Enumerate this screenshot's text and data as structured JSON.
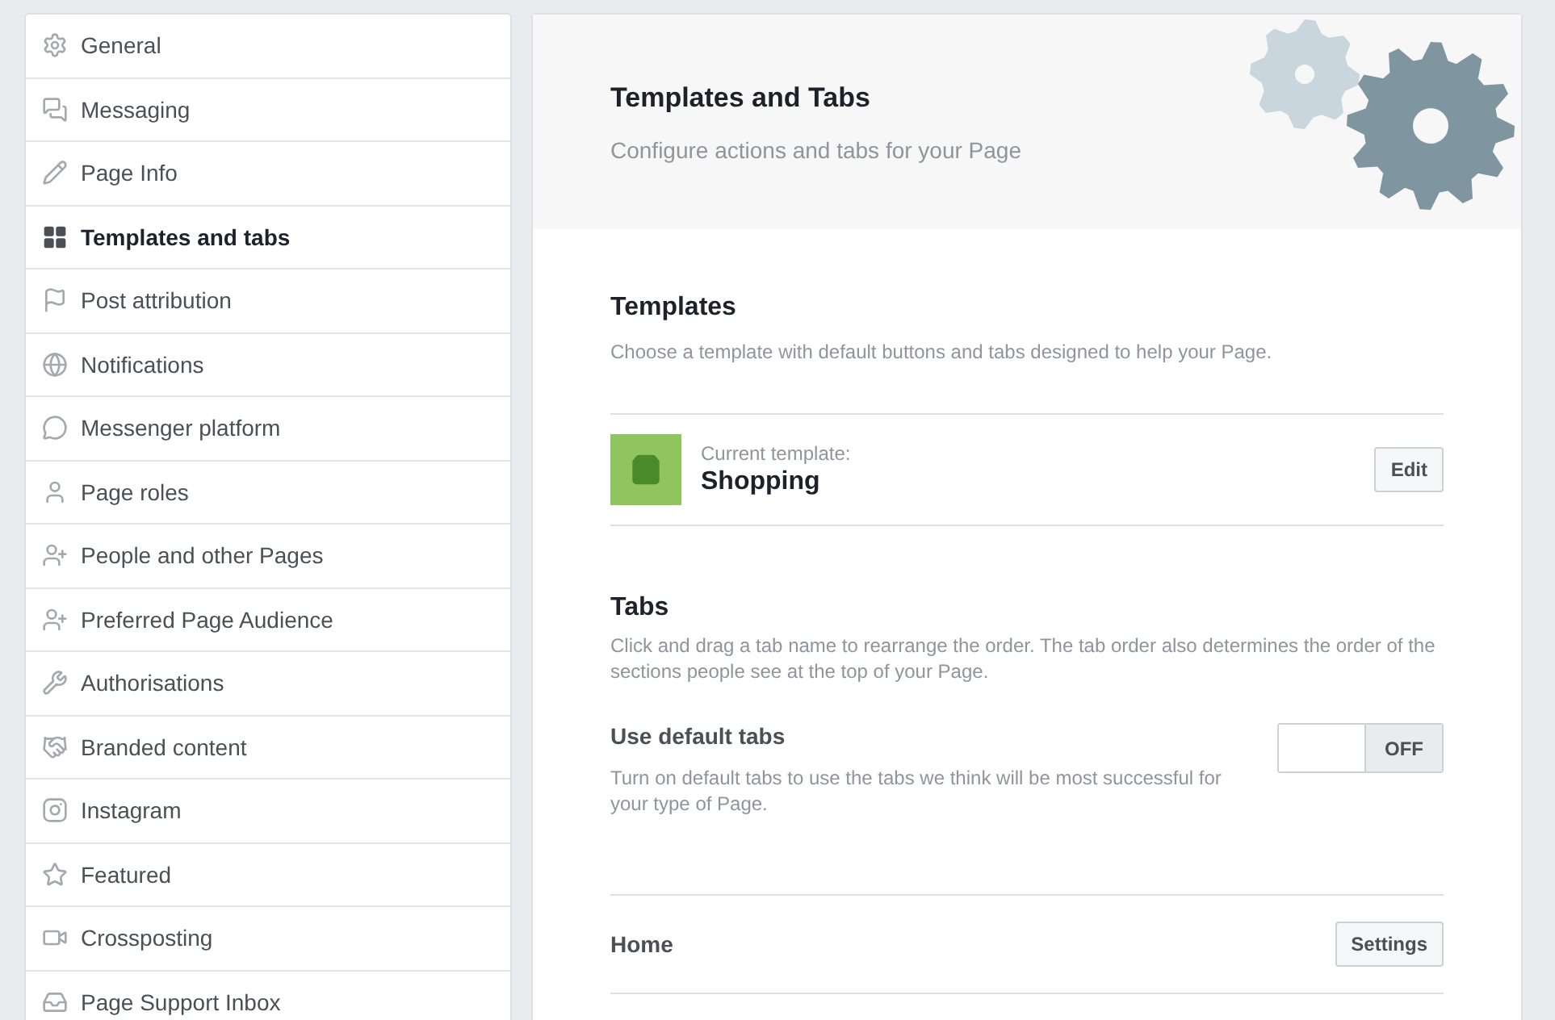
{
  "sidebar": {
    "items": [
      {
        "label": "General",
        "selected": false
      },
      {
        "label": "Messaging",
        "selected": false
      },
      {
        "label": "Page Info",
        "selected": false
      },
      {
        "label": "Templates and tabs",
        "selected": true
      },
      {
        "label": "Post attribution",
        "selected": false
      },
      {
        "label": "Notifications",
        "selected": false
      },
      {
        "label": "Messenger platform",
        "selected": false
      },
      {
        "label": "Page roles",
        "selected": false
      },
      {
        "label": "People and other Pages",
        "selected": false
      },
      {
        "label": "Preferred Page Audience",
        "selected": false
      },
      {
        "label": "Authorisations",
        "selected": false
      },
      {
        "label": "Branded content",
        "selected": false
      },
      {
        "label": "Instagram",
        "selected": false
      },
      {
        "label": "Featured",
        "selected": false
      },
      {
        "label": "Crossposting",
        "selected": false
      },
      {
        "label": "Page Support Inbox",
        "selected": false
      }
    ]
  },
  "header": {
    "title": "Templates and Tabs",
    "subtitle": "Configure actions and tabs for your Page"
  },
  "templates": {
    "title": "Templates",
    "description": "Choose a template with default buttons and tabs designed to help your Page.",
    "current_label": "Current template:",
    "current_name": "Shopping",
    "edit_button": "Edit"
  },
  "tabs": {
    "title": "Tabs",
    "description": "Click and drag a tab name to rearrange the order. The tab order also determines the order of the sections people see at the top of your Page.",
    "default_tabs": {
      "label": "Use default tabs",
      "description": "Turn on default tabs to use the tabs we think will be most successful for your type of Page.",
      "on": false,
      "state_label": "OFF"
    },
    "list": [
      {
        "name": "Home",
        "button": "Settings"
      }
    ]
  }
}
